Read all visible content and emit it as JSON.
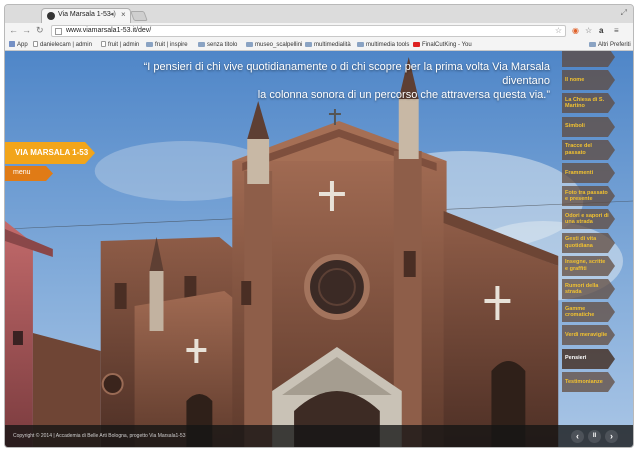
{
  "browser": {
    "tab_title": "Via Marsala 1-53",
    "url": "www.viamarsala1-53.it/dev/",
    "bookmarks": [
      "App",
      "danielecam | admin",
      "fruit | admin",
      "fruit | inspire",
      "senza titolo",
      "museo_scalpellini",
      "multimedialità",
      "multimedia tools",
      "FinalCutKing - You",
      "Altri Preferiti"
    ]
  },
  "page": {
    "quote_line1": "“I pensieri di chi vive quotidianamente o di chi scopre per la prima volta Via Marsala diventano",
    "quote_line2": "la colonna sonora di un percorso che attraversa questa via.”",
    "main_label": "VIA MARSALA 1-53",
    "menu_label": "menu",
    "copyright": "Copyright © 2014 | Accademia di Belle Arti Bologna, progetto Via Marsala1-53",
    "controls": {
      "prev": "‹",
      "pause": "II",
      "next": "›"
    }
  },
  "sidenav": {
    "items": [
      {
        "label": ""
      },
      {
        "label": "Il nome"
      },
      {
        "label": "La Chiesa di S. Martino"
      },
      {
        "label": "Simboli"
      },
      {
        "label": "Tracce del passato"
      },
      {
        "label": "Frammenti"
      },
      {
        "label": "Foto tra passato e presente"
      },
      {
        "label": "Odori e sapori di una strada"
      },
      {
        "label": "Gesti di vita quotidiana"
      },
      {
        "label": "Insegne, scritte e graffiti"
      },
      {
        "label": "Rumori della strada"
      },
      {
        "label": "Gamme cromatiche"
      },
      {
        "label": "Verdi meraviglie"
      },
      {
        "label": "Pensieri",
        "active": true
      },
      {
        "label": "Testimonianze"
      }
    ]
  },
  "colors": {
    "accent": "#f2a51a",
    "nav_text": "#f2c230",
    "menu_badge": "#e07b16"
  }
}
